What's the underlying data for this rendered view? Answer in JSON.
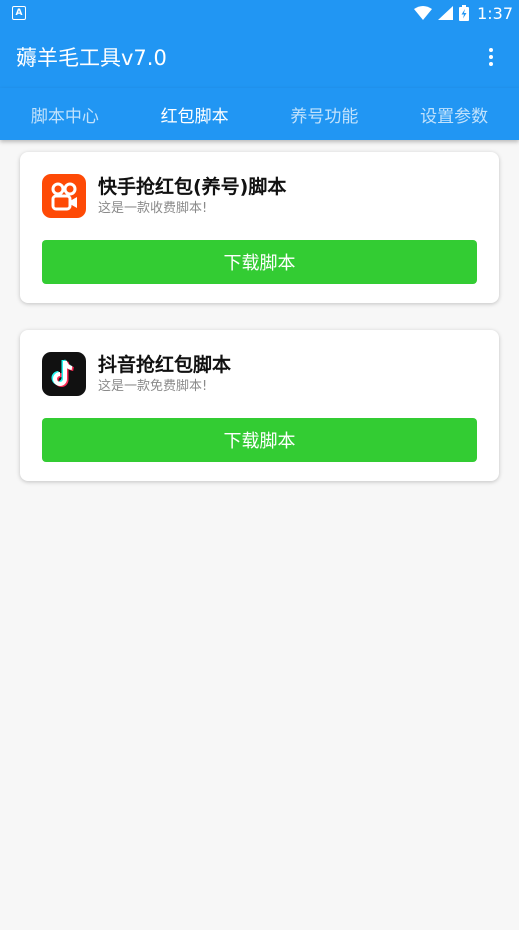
{
  "status_bar": {
    "time": "1:37",
    "icons": [
      "notification-a-icon",
      "wifi-icon",
      "signal-icon",
      "battery-charging-icon"
    ]
  },
  "app_bar": {
    "title": "薅羊毛工具v7.0",
    "menu_icon": "more-vert-icon"
  },
  "tabs": [
    {
      "label": "脚本中心",
      "active": false
    },
    {
      "label": "红包脚本",
      "active": true
    },
    {
      "label": "养号功能",
      "active": false
    },
    {
      "label": "设置参数",
      "active": false
    }
  ],
  "cards": [
    {
      "title": "快手抢红包(养号)脚本",
      "subtitle": "这是一款收费脚本!",
      "button_label": "下载脚本",
      "icon": "kuaishou-icon"
    },
    {
      "title": "抖音抢红包脚本",
      "subtitle": "这是一款免费脚本!",
      "button_label": "下载脚本",
      "icon": "douyin-icon"
    }
  ],
  "colors": {
    "primary": "#2196f3",
    "button": "#33cc33",
    "kuaishou": "#fe4a06",
    "douyin": "#111111"
  }
}
